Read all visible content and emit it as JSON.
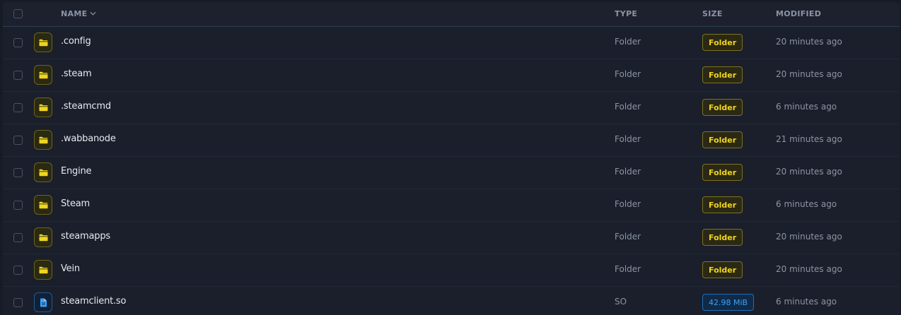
{
  "header": {
    "name": "NAME",
    "type": "TYPE",
    "size": "SIZE",
    "modified": "MODIFIED"
  },
  "colors": {
    "folder_accent": "#f1d51f",
    "file_accent": "#35a4ff",
    "background": "#1a1f2b"
  },
  "rows": [
    {
      "icon": "folder-icon",
      "kind": "folder",
      "name": ".config",
      "type": "Folder",
      "size": "Folder",
      "modified": "20 minutes ago"
    },
    {
      "icon": "folder-icon",
      "kind": "folder",
      "name": ".steam",
      "type": "Folder",
      "size": "Folder",
      "modified": "20 minutes ago"
    },
    {
      "icon": "folder-icon",
      "kind": "folder",
      "name": ".steamcmd",
      "type": "Folder",
      "size": "Folder",
      "modified": "6 minutes ago"
    },
    {
      "icon": "folder-icon",
      "kind": "folder",
      "name": ".wabbanode",
      "type": "Folder",
      "size": "Folder",
      "modified": "21 minutes ago"
    },
    {
      "icon": "folder-icon",
      "kind": "folder",
      "name": "Engine",
      "type": "Folder",
      "size": "Folder",
      "modified": "20 minutes ago"
    },
    {
      "icon": "folder-icon",
      "kind": "folder",
      "name": "Steam",
      "type": "Folder",
      "size": "Folder",
      "modified": "6 minutes ago"
    },
    {
      "icon": "folder-icon",
      "kind": "folder",
      "name": "steamapps",
      "type": "Folder",
      "size": "Folder",
      "modified": "20 minutes ago"
    },
    {
      "icon": "folder-icon",
      "kind": "folder",
      "name": "Vein",
      "type": "Folder",
      "size": "Folder",
      "modified": "20 minutes ago"
    },
    {
      "icon": "file-icon",
      "kind": "file",
      "name": "steamclient.so",
      "type": "SO",
      "size": "42.98 MiB",
      "modified": "6 minutes ago"
    }
  ]
}
